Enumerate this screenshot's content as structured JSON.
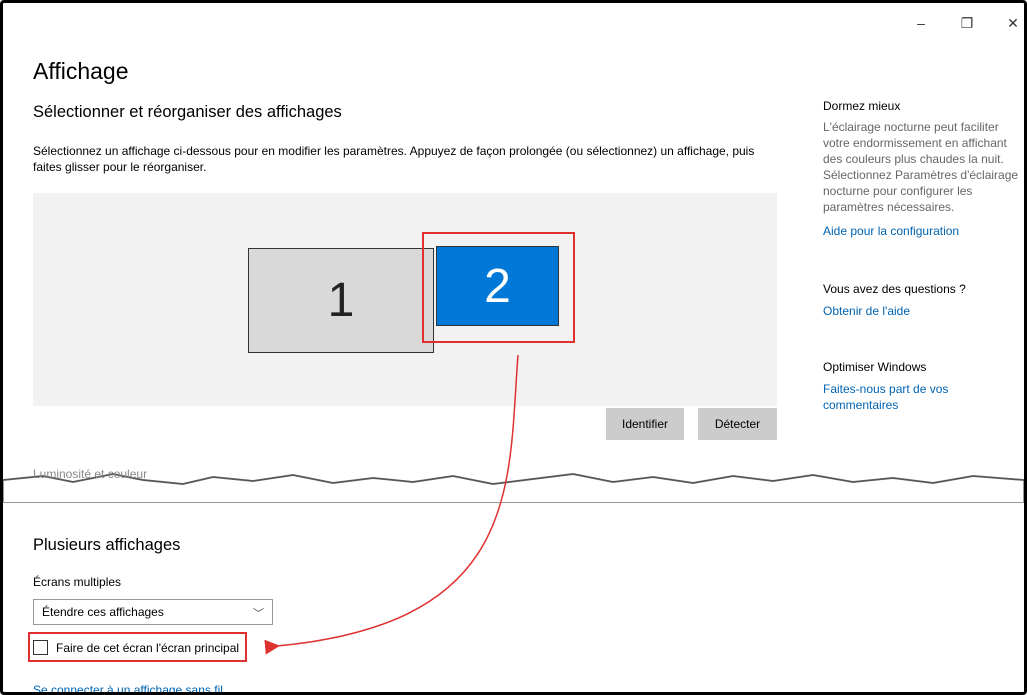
{
  "window": {
    "minimize_glyph": "–",
    "restore_glyph": "❐",
    "close_glyph": "✕"
  },
  "page": {
    "title": "Affichage",
    "section_title": "Sélectionner et réorganiser des affichages",
    "description": "Sélectionnez un affichage ci-dessous pour en modifier les paramètres. Appuyez de façon prolongée (ou sélectionnez) un affichage, puis faites glisser pour le réorganiser."
  },
  "monitors": [
    {
      "label": "1",
      "selected": false
    },
    {
      "label": "2",
      "selected": true
    }
  ],
  "buttons": {
    "identify": "Identifier",
    "detect": "Détecter"
  },
  "torn_text": "Luminosité et couleur",
  "sidebar": {
    "sleep_heading": "Dormez mieux",
    "sleep_text": "L'éclairage nocturne peut faciliter votre endormissement en affichant des couleurs plus chaudes la nuit. Sélectionnez Paramètres d'éclairage nocturne pour configurer les paramètres nécessaires.",
    "sleep_link": "Aide pour la configuration",
    "questions_heading": "Vous avez des questions ?",
    "questions_link": "Obtenir de l'aide",
    "optimize_heading": "Optimiser Windows",
    "optimize_link": "Faites-nous part de vos commentaires"
  },
  "multi": {
    "title": "Plusieurs affichages",
    "label": "Écrans multiples",
    "select_value": "Étendre ces affichages",
    "checkbox_label": "Faire de cet écran l'écran principal",
    "checkbox_checked": false,
    "wireless_link": "Se connecter à un affichage sans fil"
  },
  "colors": {
    "accent": "#0078d7",
    "link": "#0063b1",
    "highlight": "#e03131"
  }
}
